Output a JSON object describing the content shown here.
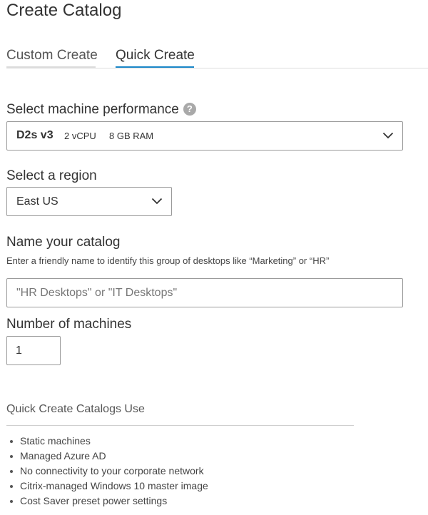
{
  "page": {
    "title": "Create Catalog"
  },
  "tabs": [
    {
      "label": "Custom Create",
      "active": false
    },
    {
      "label": "Quick Create",
      "active": true
    }
  ],
  "performance": {
    "label": "Select machine performance",
    "help_icon": "?",
    "selected": {
      "name": "D2s v3",
      "cpu": "2 vCPU",
      "ram": "8 GB RAM"
    }
  },
  "region": {
    "label": "Select a region",
    "selected": "East US"
  },
  "catalog_name": {
    "label": "Name your catalog",
    "hint": "Enter a friendly name to identify this group of desktops like “Marketing” or “HR”",
    "placeholder": "\"HR Desktops\" or \"IT Desktops\"",
    "value": ""
  },
  "machines": {
    "label": "Number of machines",
    "value": "1"
  },
  "uses": {
    "heading": "Quick Create Catalogs Use",
    "items": [
      "Static machines",
      "Managed Azure AD",
      "No connectivity to your corporate network",
      "Citrix-managed Windows 10 master image",
      "Cost Saver preset power settings"
    ]
  },
  "colors": {
    "accent": "#1a87c8",
    "border": "#9a9a9a",
    "text": "#333333"
  }
}
